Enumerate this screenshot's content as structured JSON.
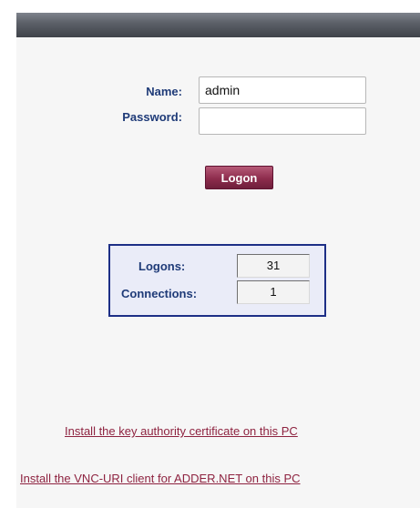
{
  "login": {
    "name_label": "Name:",
    "name_value": "admin",
    "password_label": "Password:",
    "password_value": "",
    "logon_button": "Logon"
  },
  "stats": {
    "logons_label": "Logons:",
    "logons_value": "31",
    "connections_label": "Connections:",
    "connections_value": "1"
  },
  "links": {
    "certificate": "Install the key authority certificate on this PC",
    "vnc_client": "Install the VNC-URI client for ADDER.NET on this PC"
  },
  "colors": {
    "label_blue": "#1f3b78",
    "button_maroon": "#8e2c4d",
    "link_maroon": "#8e2340",
    "stats_border": "#1d2f86"
  }
}
